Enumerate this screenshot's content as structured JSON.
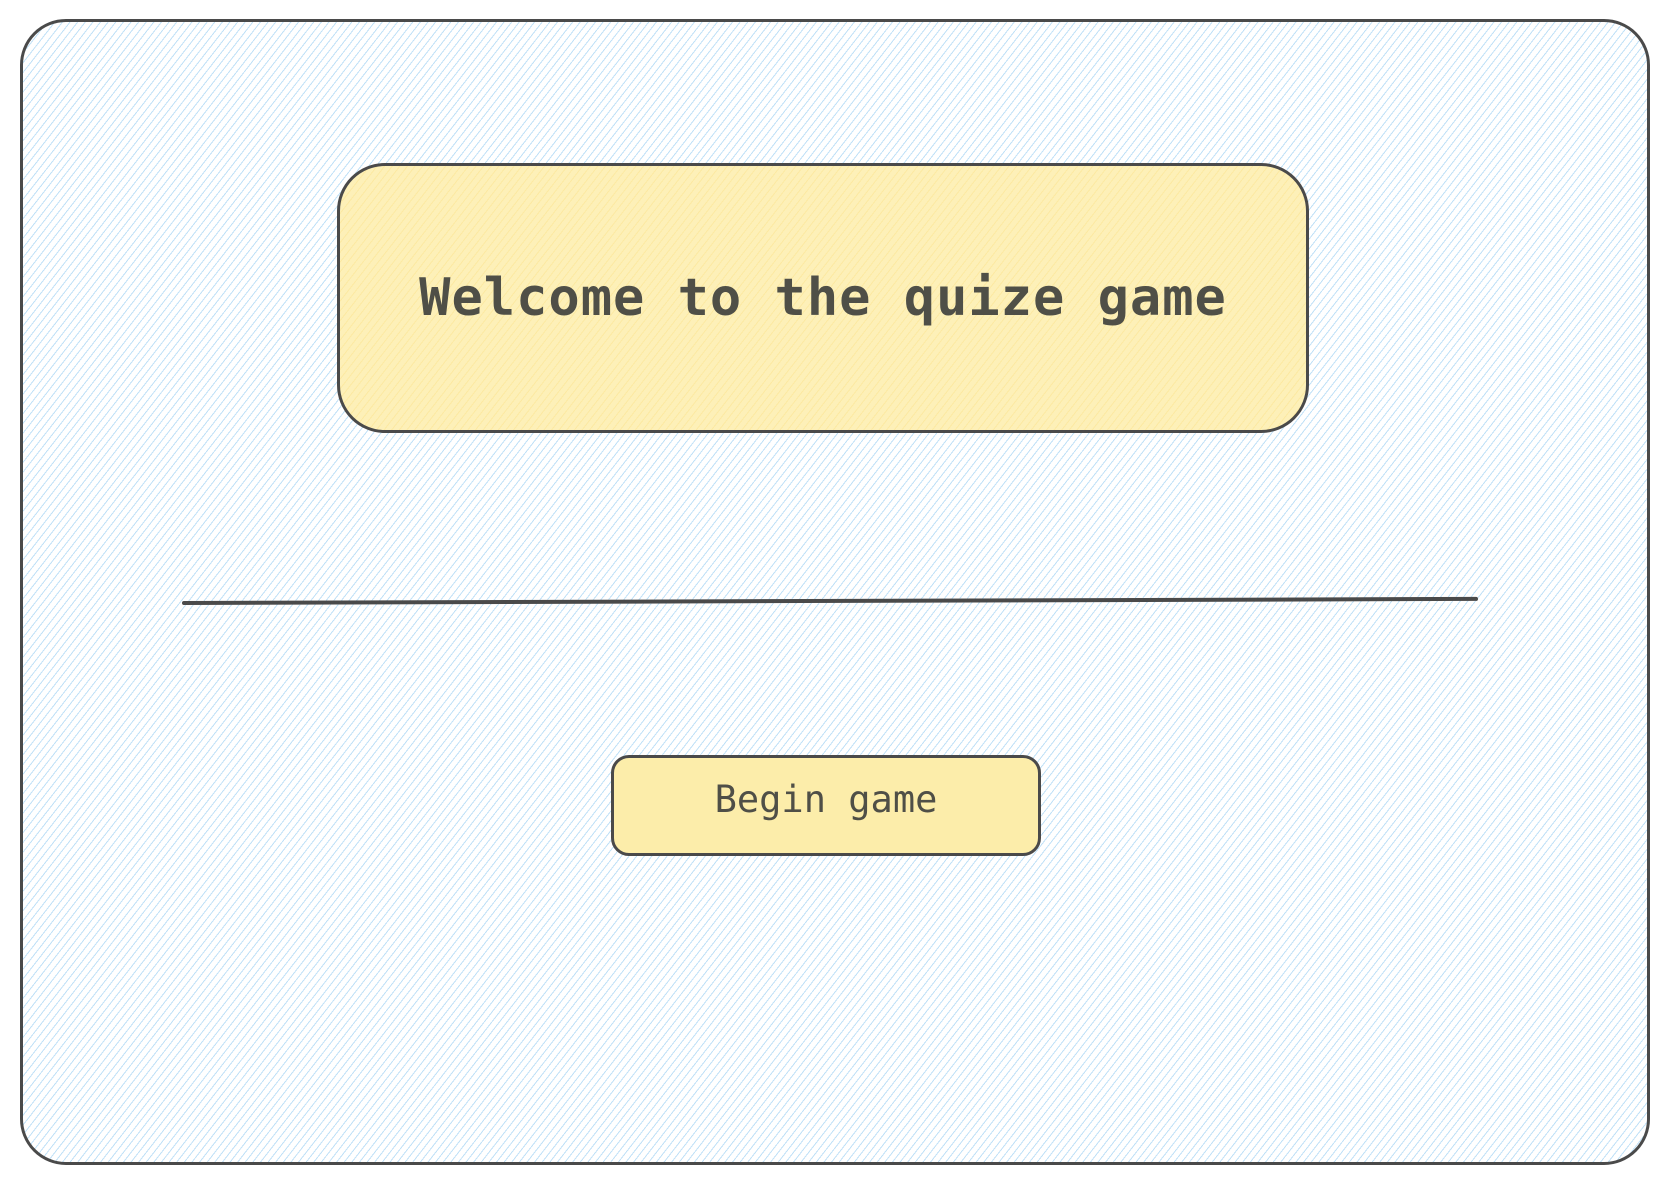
{
  "welcome": {
    "title": "Welcome to the quize game"
  },
  "actions": {
    "begin_label": "Begin game"
  },
  "colors": {
    "frame_hatch": "#8cc8f0",
    "box_fill": "#fdf0b8",
    "button_fill": "#fcedaa",
    "outline": "#4a4a4a",
    "text": "#4f4f47"
  }
}
